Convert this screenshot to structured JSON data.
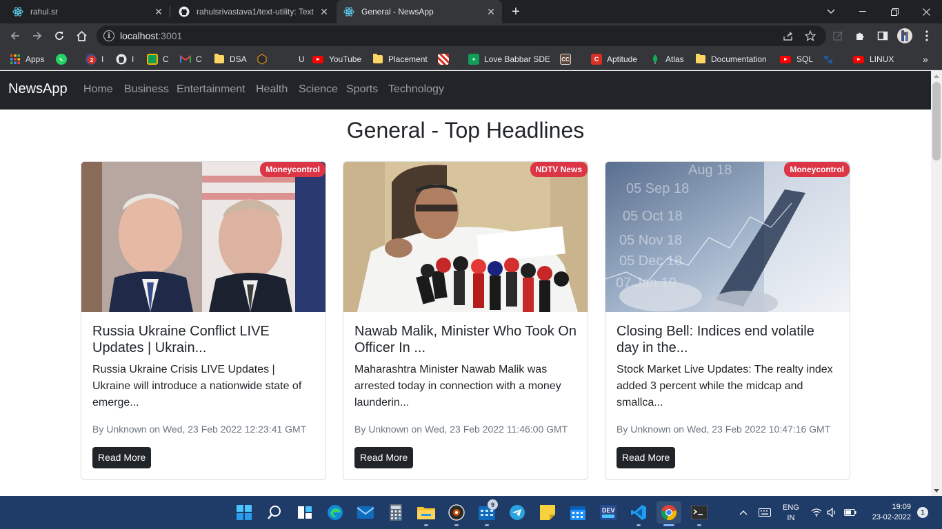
{
  "browser": {
    "tabs": [
      {
        "title": "rahul.sr",
        "icon": "react-icon",
        "active": false
      },
      {
        "title": "rahulsrivastava1/text-utility: Text",
        "icon": "github-icon",
        "active": false
      },
      {
        "title": "General - NewsApp",
        "icon": "react-icon",
        "active": true
      }
    ],
    "url_host": "localhost",
    "url_port": ":3001",
    "bookmarks": [
      {
        "label": "Apps",
        "icon": "apps-grid-icon"
      },
      {
        "label": "",
        "icon": "whatsapp-icon"
      },
      {
        "label": "I",
        "icon": "notification-badge-icon",
        "badge": "2"
      },
      {
        "label": "I",
        "icon": "github-icon"
      },
      {
        "label": "C",
        "icon": "classroom-icon"
      },
      {
        "label": "C",
        "icon": "gmail-icon"
      },
      {
        "label": "DSA",
        "icon": "folder-icon"
      },
      {
        "label": "",
        "icon": "hackerrank-icon"
      },
      {
        "label": "U",
        "icon": "blank-icon"
      },
      {
        "label": "YouTube",
        "icon": "youtube-icon"
      },
      {
        "label": "Placement",
        "icon": "folder-icon"
      },
      {
        "label": "",
        "icon": "checkered-icon"
      },
      {
        "label": "Love Babbar SDE",
        "icon": "sheet-icon"
      },
      {
        "label": "",
        "icon": "cc-icon"
      },
      {
        "label": "Aptitude",
        "icon": "c-icon"
      },
      {
        "label": "Atlas",
        "icon": "mongodb-icon"
      },
      {
        "label": "Documentation",
        "icon": "folder-icon"
      },
      {
        "label": "SQL",
        "icon": "youtube-icon"
      },
      {
        "label": "",
        "icon": "paw-icon"
      },
      {
        "label": "LINUX",
        "icon": "youtube-icon"
      }
    ],
    "bookmarks_more": "»"
  },
  "app": {
    "brand": "NewsApp",
    "nav": [
      "Home",
      "Business",
      "Entertainment",
      "Health",
      "Science",
      "Sports",
      "Technology"
    ],
    "heading": "General - Top Headlines",
    "articles": [
      {
        "source": "Moneycontrol",
        "title": "Russia Ukraine Conflict LIVE Updates | Ukrain...",
        "description": "Russia Ukraine Crisis LIVE Updates | Ukraine will introduce a nationwide state of emerge...",
        "meta": "By Unknown on Wed, 23 Feb 2022 12:23:41 GMT",
        "button": "Read More"
      },
      {
        "source": "NDTV News",
        "title": "Nawab Malik, Minister Who Took On Officer In ...",
        "description": "Maharashtra Minister Nawab Malik was arrested today in connection with a money launderin...",
        "meta": "By Unknown on Wed, 23 Feb 2022 11:46:00 GMT",
        "button": "Read More"
      },
      {
        "source": "Moneycontrol",
        "title": "Closing Bell: Indices end volatile day in the...",
        "description": "Stock Market Live Updates: The realty index added 3 percent while the midcap and smallca...",
        "meta": "By Unknown on Wed, 23 Feb 2022 10:47:16 GMT",
        "button": "Read More"
      }
    ]
  },
  "taskbar": {
    "telegram_badge": "9",
    "lang_line1": "ENG",
    "lang_line2": "IN",
    "time": "19:09",
    "date": "23-02-2022",
    "notifications": "1"
  },
  "colors": {
    "navbar": "#212529",
    "badge": "#dc3545",
    "button": "#212529",
    "taskbar": "#1f3b67"
  }
}
